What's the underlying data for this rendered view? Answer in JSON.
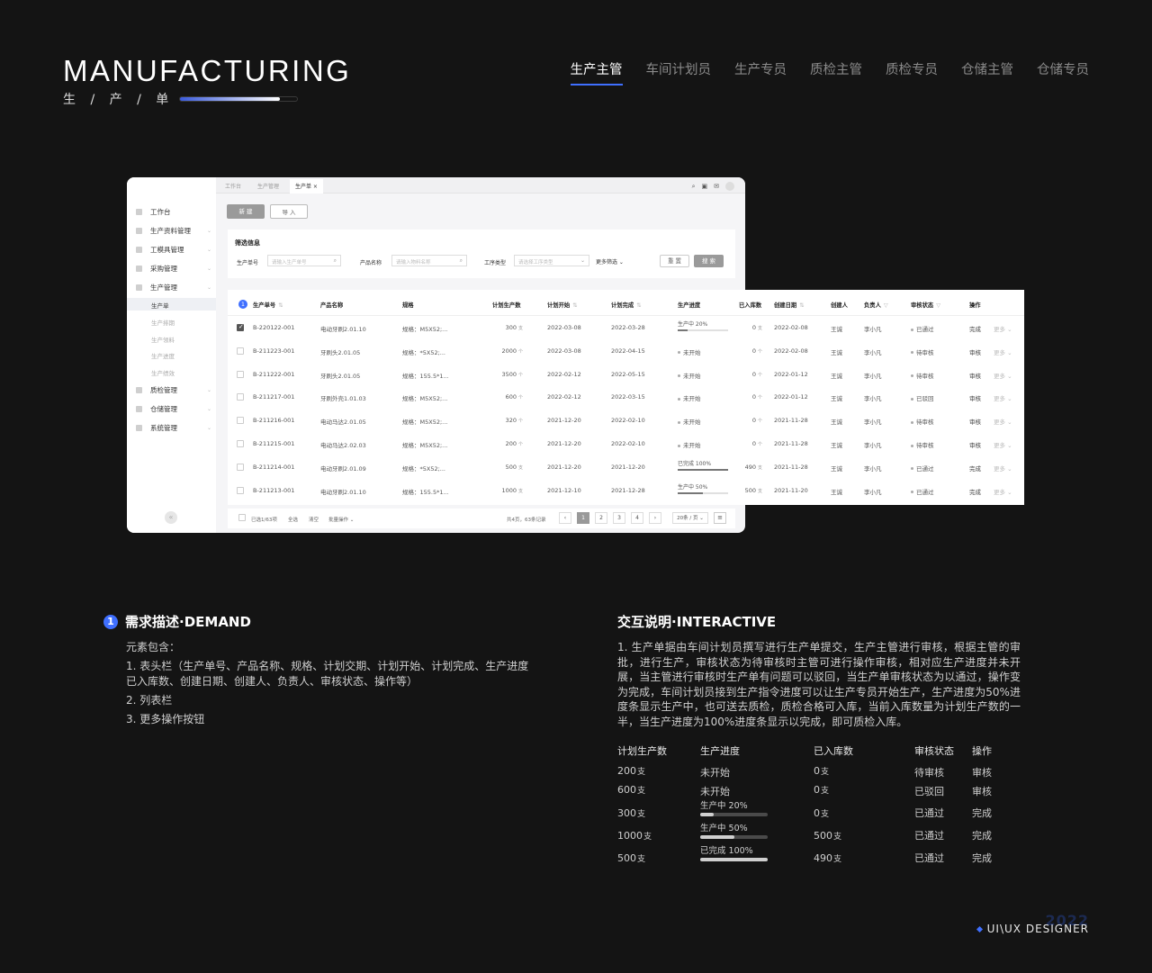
{
  "header": {
    "title": "MANUFACTURING",
    "subtitle": "生 / 产 / 单",
    "progress": 0.85,
    "roles": [
      {
        "label": "生产主管",
        "active": true
      },
      {
        "label": "车间计划员",
        "active": false
      },
      {
        "label": "生产专员",
        "active": false
      },
      {
        "label": "质检主管",
        "active": false
      },
      {
        "label": "质检专员",
        "active": false
      },
      {
        "label": "仓储主管",
        "active": false
      },
      {
        "label": "仓储专员",
        "active": false
      }
    ]
  },
  "app": {
    "tabs": [
      "工作台",
      "生产管理",
      "生产单 ×"
    ],
    "sidebar": {
      "items": [
        "工作台",
        "生产资料管理",
        "工模具管理",
        "采购管理",
        "生产管理",
        "质检管理",
        "仓储管理",
        "系统管理"
      ],
      "subitems": [
        "生产单",
        "生产排期",
        "生产领料",
        "生产进度",
        "生产绩效"
      ],
      "active_sub": "生产单"
    },
    "buttons": {
      "new": "新 建",
      "import": "导 入",
      "reset": "重 置",
      "search": "搜 索"
    },
    "filter": {
      "title": "筛选信息",
      "fields": [
        {
          "label": "生产单号",
          "placeholder": "请输入生产单号"
        },
        {
          "label": "产品名称",
          "placeholder": "请输入物料名称"
        },
        {
          "label": "工序类型",
          "placeholder": "请选择工序类型"
        }
      ],
      "more": "更多筛选 ⌄"
    },
    "table": {
      "badge": "1",
      "headers": [
        "生产单号",
        "产品名称",
        "规格",
        "计划生产数",
        "计划开始",
        "计划完成",
        "生产进度",
        "已入库数",
        "创建日期",
        "创建人",
        "负责人",
        "审核状态",
        "操作"
      ],
      "rows": [
        {
          "checked": true,
          "id": "B-220122-001",
          "name": "电动牙刷2.01.10",
          "spec": "规格：M5X52;...",
          "qty": "300",
          "unit": "支",
          "start": "2022-03-08",
          "end": "2022-03-28",
          "progress_label": "生产中 20%",
          "progress": 0.2,
          "stored": "0",
          "stored_unit": "支",
          "created": "2022-02-08",
          "creator": "王诚",
          "owner": "李小凡",
          "status": "已通过",
          "op": "完成",
          "more": "更多 ⌄"
        },
        {
          "checked": false,
          "id": "B-211223-001",
          "name": "牙刷头2.01.05",
          "spec": "规格：*5X52;...",
          "qty": "2000",
          "unit": "个",
          "start": "2022-03-08",
          "end": "2022-04-15",
          "progress_label": "未开始",
          "progress": null,
          "stored": "0",
          "stored_unit": "个",
          "created": "2022-02-08",
          "creator": "王诚",
          "owner": "李小凡",
          "status": "待审核",
          "op": "审核",
          "more": "更多 ⌄"
        },
        {
          "checked": false,
          "id": "B-211222-001",
          "name": "牙刷头2.01.05",
          "spec": "规格：155.5*1...",
          "qty": "3500",
          "unit": "个",
          "start": "2022-02-12",
          "end": "2022-05-15",
          "progress_label": "未开始",
          "progress": null,
          "stored": "0",
          "stored_unit": "个",
          "created": "2022-01-12",
          "creator": "王诚",
          "owner": "李小凡",
          "status": "待审核",
          "op": "审核",
          "more": "更多 ⌄"
        },
        {
          "checked": false,
          "id": "B-211217-001",
          "name": "牙刷外壳1.01.03",
          "spec": "规格：M5X52;...",
          "qty": "600",
          "unit": "个",
          "start": "2022-02-12",
          "end": "2022-03-15",
          "progress_label": "未开始",
          "progress": null,
          "stored": "0",
          "stored_unit": "个",
          "created": "2022-01-12",
          "creator": "王诚",
          "owner": "李小凡",
          "status": "已驳回",
          "op": "审核",
          "more": "更多 ⌄"
        },
        {
          "checked": false,
          "id": "B-211216-001",
          "name": "电动马达2.01.05",
          "spec": "规格：M5X52;...",
          "qty": "320",
          "unit": "个",
          "start": "2021-12-20",
          "end": "2022-02-10",
          "progress_label": "未开始",
          "progress": null,
          "stored": "0",
          "stored_unit": "个",
          "created": "2021-11-28",
          "creator": "王诚",
          "owner": "李小凡",
          "status": "待审核",
          "op": "审核",
          "more": "更多 ⌄"
        },
        {
          "checked": false,
          "id": "B-211215-001",
          "name": "电动马达2.02.03",
          "spec": "规格：M5X52;...",
          "qty": "200",
          "unit": "个",
          "start": "2021-12-20",
          "end": "2022-02-10",
          "progress_label": "未开始",
          "progress": null,
          "stored": "0",
          "stored_unit": "个",
          "created": "2021-11-28",
          "creator": "王诚",
          "owner": "李小凡",
          "status": "待审核",
          "op": "审核",
          "more": "更多 ⌄"
        },
        {
          "checked": false,
          "id": "B-211214-001",
          "name": "电动牙刷2.01.09",
          "spec": "规格：*5X52;...",
          "qty": "500",
          "unit": "支",
          "start": "2021-12-20",
          "end": "2021-12-20",
          "progress_label": "已完成 100%",
          "progress": 1.0,
          "stored": "490",
          "stored_unit": "支",
          "created": "2021-11-28",
          "creator": "王诚",
          "owner": "李小凡",
          "status": "已通过",
          "op": "完成",
          "more": "更多 ⌄"
        },
        {
          "checked": false,
          "id": "B-211213-001",
          "name": "电动牙刷2.01.10",
          "spec": "规格：155.5*1...",
          "qty": "1000",
          "unit": "支",
          "start": "2021-12-10",
          "end": "2021-12-28",
          "progress_label": "生产中 50%",
          "progress": 0.5,
          "stored": "500",
          "stored_unit": "支",
          "created": "2021-11-20",
          "creator": "王诚",
          "owner": "李小凡",
          "status": "已通过",
          "op": "完成",
          "more": "更多 ⌄"
        }
      ]
    },
    "pagination": {
      "selected": "已选1/63项",
      "select_all": "全选",
      "clear": "清空",
      "batch": "批量操作 ⌄",
      "summary": "共4页，63条记录",
      "pages": [
        "‹",
        "1",
        "2",
        "3",
        "4",
        "›"
      ],
      "active_page": "1",
      "page_size": "20条 / 页 ⌄",
      "menu": "≡"
    }
  },
  "demand": {
    "badge": "1",
    "title": "需求描述·DEMAND",
    "intro": "元素包含：",
    "items": [
      "1. 表头栏（生产单号、产品名称、规格、计划交期、计划开始、计划完成、生产进度已入库数、创建日期、创建人、负责人、审核状态、操作等）",
      "2. 列表栏",
      "3. 更多操作按钮"
    ]
  },
  "interactive": {
    "title": "交互说明·INTERACTIVE",
    "text": "1. 生产单据由车间计划员撰写进行生产单提交，生产主管进行审核，根据主管的审批，进行生产，审核状态为待审核时主管可进行操作审核，相对应生产进度并未开展，当主管进行审核时生产单有问题可以驳回，当生产单审核状态为以通过，操作变为完成，车间计划员接到生产指令进度可以让生产专员开始生产，生产进度为50%进度条显示生产中，也可送去质检，质检合格可入库，当前入库数量为计划生产数的一半，当生产进度为100%进度条显示以完成，即可质检入库。",
    "mini_headers": [
      "计划生产数",
      "生产进度",
      "已入库数",
      "审核状态",
      "操作"
    ],
    "mini_rows": [
      {
        "qty": "200",
        "unit": "支",
        "progress_label": "未开始",
        "progress": null,
        "stored": "0",
        "stored_unit": "支",
        "status": "待审核",
        "op": "审核"
      },
      {
        "qty": "600",
        "unit": "支",
        "progress_label": "未开始",
        "progress": null,
        "stored": "0",
        "stored_unit": "支",
        "status": "已驳回",
        "op": "审核"
      },
      {
        "qty": "300",
        "unit": "支",
        "progress_label": "生产中  20%",
        "progress": 0.2,
        "stored": "0",
        "stored_unit": "支",
        "status": "已通过",
        "op": "完成"
      },
      {
        "qty": "1000",
        "unit": "支",
        "progress_label": "生产中 50%",
        "progress": 0.5,
        "stored": "500",
        "stored_unit": "支",
        "status": "已通过",
        "op": "完成"
      },
      {
        "qty": "500",
        "unit": "支",
        "progress_label": "已完成  100%",
        "progress": 1.0,
        "stored": "490",
        "stored_unit": "支",
        "status": "已通过",
        "op": "完成"
      }
    ]
  },
  "footer": {
    "label": "UI\\UX DESIGNER",
    "deco": "2022"
  },
  "colors": {
    "accent": "#3f6fff",
    "background": "#141414"
  }
}
